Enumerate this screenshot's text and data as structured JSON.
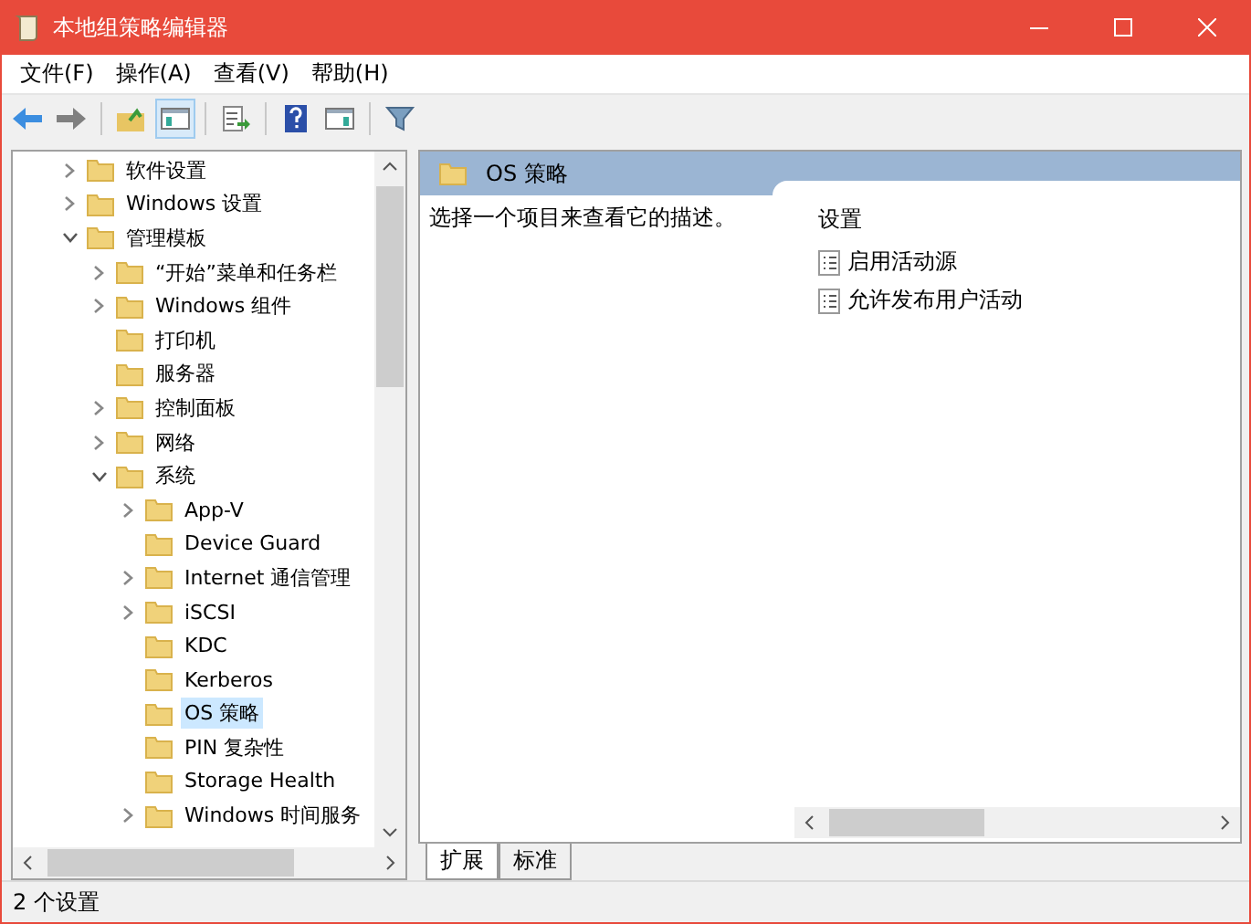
{
  "window": {
    "title": "本地组策略编辑器"
  },
  "menu": [
    {
      "label": "文件(F)"
    },
    {
      "label": "操作(A)"
    },
    {
      "label": "查看(V)"
    },
    {
      "label": "帮助(H)"
    }
  ],
  "toolbar": [
    {
      "kind": "back"
    },
    {
      "kind": "forward"
    },
    {
      "kind": "sep"
    },
    {
      "kind": "up"
    },
    {
      "kind": "tree",
      "selected": true
    },
    {
      "kind": "sep"
    },
    {
      "kind": "export"
    },
    {
      "kind": "sep"
    },
    {
      "kind": "help"
    },
    {
      "kind": "view"
    },
    {
      "kind": "sep"
    },
    {
      "kind": "filter"
    }
  ],
  "tree": [
    {
      "label": "软件设置",
      "expanded": false,
      "selected": false
    },
    {
      "label": "Windows 设置",
      "expanded": false,
      "selected": false
    },
    {
      "label": "管理模板",
      "expanded": true,
      "selected": false,
      "children": [
        {
          "label": "“开始”菜单和任务栏",
          "expanded": false,
          "selected": false
        },
        {
          "label": "Windows 组件",
          "expanded": false,
          "selected": false
        },
        {
          "label": "打印机",
          "selected": false
        },
        {
          "label": "服务器",
          "selected": false
        },
        {
          "label": "控制面板",
          "expanded": false,
          "selected": false
        },
        {
          "label": "网络",
          "expanded": false,
          "selected": false
        },
        {
          "label": "系统",
          "expanded": true,
          "selected": false,
          "children": [
            {
              "label": "App-V",
              "expanded": false,
              "selected": false
            },
            {
              "label": "Device Guard",
              "selected": false
            },
            {
              "label": "Internet 通信管理",
              "expanded": false,
              "selected": false
            },
            {
              "label": "iSCSI",
              "expanded": false,
              "selected": false
            },
            {
              "label": "KDC",
              "selected": false
            },
            {
              "label": "Kerberos",
              "selected": false
            },
            {
              "label": "OS 策略",
              "selected": true
            },
            {
              "label": "PIN 复杂性",
              "selected": false
            },
            {
              "label": "Storage Health",
              "selected": false
            },
            {
              "label": "Windows 时间服务",
              "expanded": false,
              "selected": false
            }
          ]
        }
      ]
    }
  ],
  "details": {
    "heading": "OS 策略",
    "description": "选择一个项目来查看它的描述。",
    "settings_header": "设置",
    "settings": [
      {
        "label": "启用活动源"
      },
      {
        "label": "允许发布用户活动"
      }
    ]
  },
  "tabs": [
    {
      "label": "扩展",
      "selected": true
    },
    {
      "label": "标准",
      "selected": false
    }
  ],
  "status_bar": {
    "text": "2 个设置"
  }
}
